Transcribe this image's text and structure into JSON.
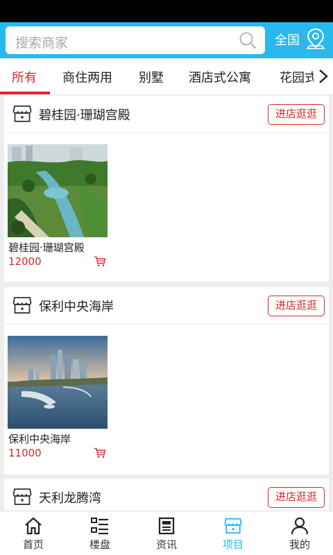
{
  "search": {
    "placeholder": "搜索商家",
    "region": "全国"
  },
  "tabs": [
    {
      "label": "所有",
      "active": true
    },
    {
      "label": "商住两用"
    },
    {
      "label": "别墅"
    },
    {
      "label": "酒店式公寓"
    },
    {
      "label": "花园式"
    }
  ],
  "shops": [
    {
      "name": "碧桂园·珊瑚宫殿",
      "visit_label": "进店逛逛",
      "product": {
        "name": "碧桂园·珊瑚宫殿",
        "price": "12000"
      }
    },
    {
      "name": "保利中央海岸",
      "visit_label": "进店逛逛",
      "product": {
        "name": "保利中央海岸",
        "price": "11000"
      }
    },
    {
      "name": "天利龙腾湾",
      "visit_label": "进店逛逛"
    }
  ],
  "bottom_nav": [
    {
      "label": "首页",
      "icon": "home-icon"
    },
    {
      "label": "楼盘",
      "icon": "list-icon"
    },
    {
      "label": "资讯",
      "icon": "news-icon"
    },
    {
      "label": "项目",
      "icon": "store-icon",
      "active": true
    },
    {
      "label": "我的",
      "icon": "user-icon"
    }
  ],
  "colors": {
    "accent": "#2ab9ee",
    "red": "#e0252b"
  }
}
